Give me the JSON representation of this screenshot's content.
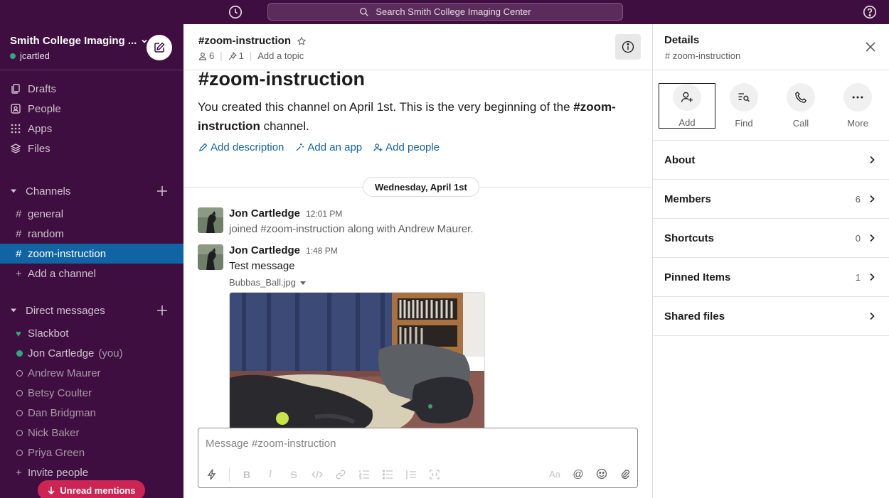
{
  "topbar": {
    "search_placeholder": "Search Smith College Imaging Center",
    "history_icon": "clock-icon",
    "help_icon": "help-icon"
  },
  "workspace": {
    "name": "Smith College Imaging ...",
    "user": "jcartled",
    "status_color": "#2bac76"
  },
  "nav": [
    {
      "label": "Drafts",
      "icon": "drafts-icon"
    },
    {
      "label": "People",
      "icon": "people-icon"
    },
    {
      "label": "Apps",
      "icon": "apps-icon"
    },
    {
      "label": "Files",
      "icon": "files-icon"
    }
  ],
  "channels": {
    "heading": "Channels",
    "items": [
      {
        "label": "general"
      },
      {
        "label": "random"
      },
      {
        "label": "zoom-instruction",
        "active": true
      }
    ],
    "add_label": "Add a channel"
  },
  "dms": {
    "heading": "Direct messages",
    "items": [
      {
        "label": "Slackbot",
        "status": "bot"
      },
      {
        "label": "Jon Cartledge",
        "suffix": "(you)",
        "status": "online"
      },
      {
        "label": "Andrew Maurer",
        "status": "away"
      },
      {
        "label": "Betsy Coulter",
        "status": "away"
      },
      {
        "label": "Dan Bridgman",
        "status": "away"
      },
      {
        "label": "Nick Baker",
        "status": "away"
      },
      {
        "label": "Priya Green",
        "status": "away"
      }
    ],
    "invite_label": "Invite people"
  },
  "unread_label": "Unread mentions",
  "channel": {
    "name": "#zoom-instruction",
    "member_count": "6",
    "pinned_count": "1",
    "topic_placeholder": "Add a topic",
    "intro_title": "#zoom-instruction",
    "intro_text_before": "You created this channel on April 1st. This is the very beginning of the ",
    "intro_channel": "#zoom-instruction",
    "intro_text_after": " channel.",
    "actions": {
      "add_description": "Add description",
      "add_app": "Add an app",
      "add_people": "Add people"
    },
    "date_divider": "Wednesday, April 1st"
  },
  "messages": [
    {
      "author": "Jon Cartledge",
      "time": "12:01 PM",
      "text": "joined #zoom-instruction along with Andrew Maurer."
    },
    {
      "author": "Jon Cartledge",
      "time": "1:48 PM",
      "text": "Test message",
      "file": "Bubbas_Ball.jpg"
    }
  ],
  "composer": {
    "placeholder": "Message #zoom-instruction",
    "format_label": "Aa"
  },
  "details": {
    "title": "Details",
    "subtitle": "# zoom-instruction",
    "actions": [
      {
        "label": "Add",
        "icon": "add-person-icon"
      },
      {
        "label": "Find",
        "icon": "find-icon"
      },
      {
        "label": "Call",
        "icon": "phone-icon"
      },
      {
        "label": "More",
        "icon": "more-icon"
      }
    ],
    "rows": [
      {
        "label": "About",
        "count": ""
      },
      {
        "label": "Members",
        "count": "6"
      },
      {
        "label": "Shortcuts",
        "count": "0"
      },
      {
        "label": "Pinned Items",
        "count": "1"
      },
      {
        "label": "Shared files",
        "count": ""
      }
    ]
  },
  "colors": {
    "sidebar": "#3f0e40",
    "active": "#1164a3",
    "link": "#1264a3",
    "unread": "#cd2553"
  }
}
